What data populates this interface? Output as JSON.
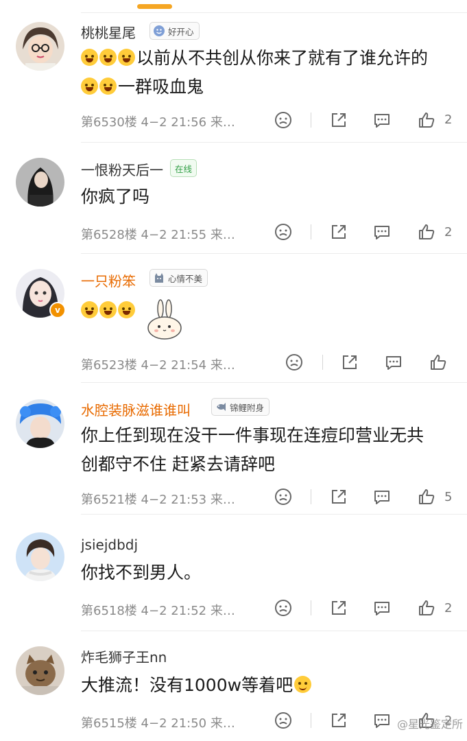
{
  "comments": [
    {
      "username": "桃桃星尾",
      "badge": "好开心",
      "lines": [
        "以前从不共创从你来了就有了谁允许的",
        "一群吸血鬼"
      ],
      "floor": "第6530楼",
      "time": "4−2 21:56",
      "source": "来…",
      "likes": "2"
    },
    {
      "username": "一恨粉天后一",
      "badge": "在线",
      "lines": [
        "你疯了吗"
      ],
      "floor": "第6528楼",
      "time": "4−2 21:55",
      "source": "来…",
      "likes": "2"
    },
    {
      "username": "一只粉笨",
      "badge": "心情不美",
      "lines": [
        ""
      ],
      "floor": "第6523楼",
      "time": "4−2 21:54",
      "source": "来…",
      "likes": ""
    },
    {
      "username": "水腔装脉滋谁谁叫",
      "badge": "锦鲤附身",
      "lines": [
        "你上任到现在没干一件事现在连痘印营业无共",
        "创都守不住 赶紧去请辞吧"
      ],
      "floor": "第6521楼",
      "time": "4−2 21:53",
      "source": "来…",
      "likes": "5"
    },
    {
      "username": "jsiejdbdj",
      "badge": "",
      "lines": [
        "你找不到男人。"
      ],
      "floor": "第6518楼",
      "time": "4−2 21:52",
      "source": "来…",
      "likes": "2"
    },
    {
      "username": "炸毛狮子王nn",
      "badge": "",
      "lines": [
        "大推流！没有1000w等着吧"
      ],
      "floor": "第6515楼",
      "time": "4−2 21:50",
      "source": "来…",
      "likes": "2"
    }
  ],
  "watermark": "@星光鉴定所",
  "colors": {
    "accent": "#f5a623",
    "orange_name": "#e86a00",
    "verified": "#f29100",
    "meta": "#8a8a8a"
  }
}
